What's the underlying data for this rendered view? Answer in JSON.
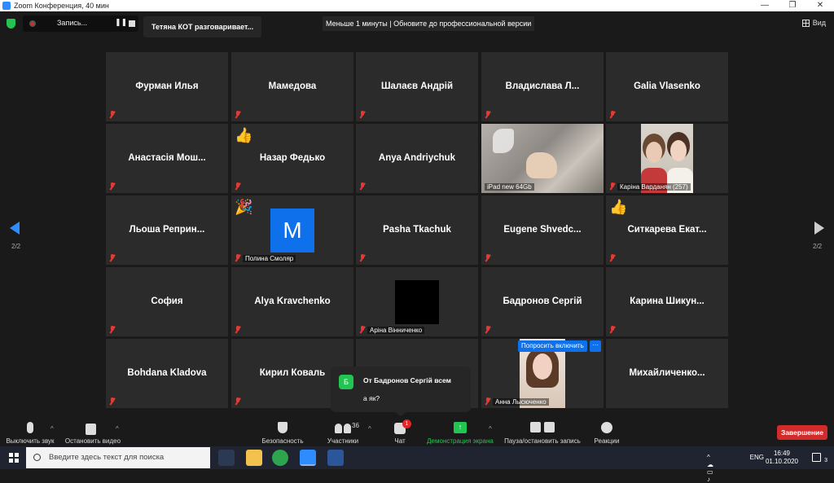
{
  "window": {
    "title": "Zoom Конференция, 40 мин",
    "controls": [
      "—",
      "❐",
      "✕"
    ]
  },
  "topbar": {
    "recording_label": "Запись...",
    "recording_pause": "❚❚",
    "speaking": "Тетяна КОТ разговаривает...",
    "banner": "Меньше 1 минуты | Обновите до профессиональной версии",
    "view_label": "Вид"
  },
  "tiles": [
    {
      "name": "Фурман Илья"
    },
    {
      "name": "Мамедова"
    },
    {
      "name": "Шалаєв Андрій"
    },
    {
      "name": "Владислава  Л..."
    },
    {
      "name": "Galia Vlasenko"
    },
    {
      "name": "Анастасія Мош..."
    },
    {
      "name": "Назар Федько",
      "emoji": "👍"
    },
    {
      "name": "Anya Andriychuk"
    },
    {
      "caption": "iPad new 64Gb"
    },
    {
      "caption": "Каріна Варданян (257)"
    },
    {
      "name": "Льоша  Реприн..."
    },
    {
      "caption": "Полина Смоляр",
      "avatar_letter": "M",
      "emoji": "🎉"
    },
    {
      "name": "Pasha Tkachuk"
    },
    {
      "name": "Eugene  Shvedc..."
    },
    {
      "name": "Ситкарева  Екат...",
      "emoji": "👍"
    },
    {
      "name": "София"
    },
    {
      "name": "Alya Kravchenko"
    },
    {
      "caption": "Аріна Вінниченко"
    },
    {
      "name": "Бадронов Сергій"
    },
    {
      "name": "Карина  Шикун..."
    },
    {
      "name": "Bohdana Kladova"
    },
    {
      "name": "Кирил Коваль"
    },
    {
      "name": ""
    },
    {
      "caption": "Анна Лысюченко"
    },
    {
      "name": "Михайличенко..."
    }
  ],
  "tile_actions": {
    "ask_unmute": "Попросить включить",
    "more": "···"
  },
  "pager": {
    "left": "2/2",
    "right": "2/2"
  },
  "chat_popup": {
    "avatar": "Б",
    "from": "От Бадронов Сергій всем",
    "message": "а як?"
  },
  "toolbar": {
    "mute": "Выключить звук",
    "video": "Остановить видео",
    "security": "Безопасность",
    "participants": "Участники",
    "participants_count": "36",
    "chat": "Чат",
    "chat_badge": "1",
    "share": "Демонстрация экрана",
    "share_icon": "↑",
    "record": "Пауза/остановить запись",
    "reactions": "Реакции",
    "caret": "^",
    "end": "Завершение"
  },
  "taskbar": {
    "search_placeholder": "Введите здесь текст для поиска",
    "language": "ENG",
    "time": "16:49",
    "date": "01.10.2020",
    "notifications": "3",
    "tray_icons": "^  ☁  ▭  ♪"
  },
  "colors": {
    "zoom_blue": "#0e71eb",
    "end_red": "#d22b2b",
    "share_green": "#23c552"
  }
}
